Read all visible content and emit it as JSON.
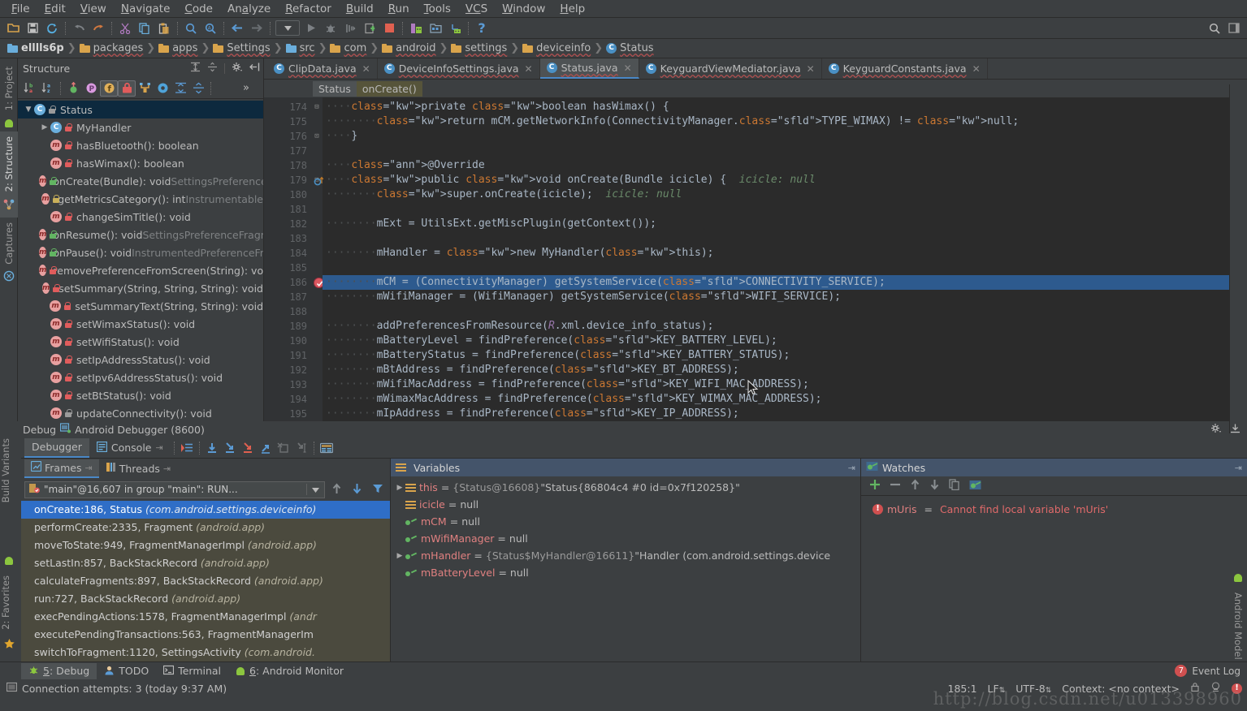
{
  "menubar": {
    "items": [
      "File",
      "Edit",
      "View",
      "Navigate",
      "Code",
      "Analyze",
      "Refactor",
      "Build",
      "Run",
      "Tools",
      "VCS",
      "Window",
      "Help"
    ]
  },
  "toolbar": {
    "icons": [
      "open-folder-icon",
      "save-all-icon",
      "sync-icon",
      "undo-icon",
      "redo-icon",
      "cut-icon",
      "copy-icon",
      "paste-icon",
      "find-icon",
      "replace-icon",
      "back-icon",
      "forward-icon",
      "run-config-dropdown",
      "run-icon",
      "debug-icon",
      "run-coverage-icon",
      "attach-debugger-icon",
      "stop-icon",
      "avd-manager-icon",
      "sdk-manager-icon",
      "sync-gradle-icon",
      "help-icon"
    ],
    "right_icons": [
      "search-everywhere-icon",
      "layout-icon"
    ]
  },
  "breadcrumbs": [
    {
      "label": "elllls6p",
      "icon": "module-icon"
    },
    {
      "label": "packages",
      "icon": "folder-icon"
    },
    {
      "label": "apps",
      "icon": "folder-icon"
    },
    {
      "label": "Settings",
      "icon": "folder-icon"
    },
    {
      "label": "src",
      "icon": "source-folder-icon"
    },
    {
      "label": "com",
      "icon": "package-icon"
    },
    {
      "label": "android",
      "icon": "package-icon"
    },
    {
      "label": "settings",
      "icon": "package-icon"
    },
    {
      "label": "deviceinfo",
      "icon": "package-icon"
    },
    {
      "label": "Status",
      "icon": "class-icon"
    }
  ],
  "left_strip": {
    "labels": [
      "1: Project",
      "2: Structure",
      "Captures"
    ],
    "bottom_labels": [
      "Build Variants",
      "2: Favorites"
    ]
  },
  "right_strip": {
    "label": "Android Model"
  },
  "structure": {
    "title": "Structure",
    "header_icons": [
      "expand-all-icon",
      "collapse-all-icon",
      "settings-gear-icon",
      "hide-panel-icon"
    ],
    "toolbar_icons": [
      "sort-by-visibility-icon",
      "sort-alphabetically-icon",
      "show-inherited-icon",
      "show-properties-icon",
      "show-fields-icon",
      "show-non-public-icon",
      "group-by-icon",
      "show-anonymous-icon",
      "expand-all-icon",
      "collapse-all-icon",
      "more-icon"
    ],
    "tree": [
      {
        "label": "Status",
        "kind": "class",
        "vis": "package",
        "expand": "open",
        "indent": 0,
        "selected": true
      },
      {
        "label": "MyHandler",
        "kind": "class",
        "vis": "private",
        "expand": "closed",
        "indent": 1
      },
      {
        "label": "hasBluetooth(): boolean",
        "kind": "method",
        "vis": "private",
        "indent": 1
      },
      {
        "label": "hasWimax(): boolean",
        "kind": "method",
        "vis": "private",
        "indent": 1
      },
      {
        "label": "onCreate(Bundle): void",
        "suffix": "SettingsPreferenceFragment",
        "kind": "method",
        "vis": "public",
        "indent": 1
      },
      {
        "label": "getMetricsCategory(): int",
        "suffix": "Instrumentable",
        "kind": "method",
        "vis": "key",
        "indent": 1
      },
      {
        "label": "changeSimTitle(): void",
        "kind": "method",
        "vis": "private",
        "indent": 1
      },
      {
        "label": "onResume(): void",
        "suffix": "SettingsPreferenceFragment",
        "kind": "method",
        "vis": "public",
        "indent": 1
      },
      {
        "label": "onPause(): void",
        "suffix": "InstrumentedPreferenceFragment",
        "kind": "method",
        "vis": "public",
        "indent": 1
      },
      {
        "label": "removePreferenceFromScreen(String): void",
        "kind": "method",
        "vis": "private",
        "indent": 1
      },
      {
        "label": "setSummary(String, String, String): void",
        "kind": "method",
        "vis": "private",
        "indent": 1
      },
      {
        "label": "setSummaryText(String, String): void",
        "kind": "method",
        "vis": "private",
        "indent": 1
      },
      {
        "label": "setWimaxStatus(): void",
        "kind": "method",
        "vis": "private",
        "indent": 1
      },
      {
        "label": "setWifiStatus(): void",
        "kind": "method",
        "vis": "private",
        "indent": 1
      },
      {
        "label": "setIpAddressStatus(): void",
        "kind": "method",
        "vis": "private",
        "indent": 1
      },
      {
        "label": "setIpv6AddressStatus(): void",
        "kind": "method",
        "vis": "private",
        "indent": 1
      },
      {
        "label": "setBtStatus(): void",
        "kind": "method",
        "vis": "private",
        "indent": 1
      },
      {
        "label": "updateConnectivity(): void",
        "kind": "method",
        "vis": "package",
        "indent": 1
      }
    ]
  },
  "editor": {
    "tabs": [
      {
        "label": "ClipData.java",
        "active": false
      },
      {
        "label": "DeviceInfoSettings.java",
        "active": false
      },
      {
        "label": "Status.java",
        "active": true
      },
      {
        "label": "KeyguardViewMediator.java",
        "active": false
      },
      {
        "label": "KeyguardConstants.java",
        "active": false
      }
    ],
    "breadcrumb_chips": [
      "Status",
      "onCreate()"
    ],
    "first_line_no": 174,
    "lines": [
      {
        "no": 174,
        "text": "    private boolean hasWimax() {"
      },
      {
        "no": 175,
        "text": "        return mCM.getNetworkInfo(ConnectivityManager.TYPE_WIMAX) != null;"
      },
      {
        "no": 176,
        "text": "    }"
      },
      {
        "no": 177,
        "text": ""
      },
      {
        "no": 178,
        "text": "    @Override"
      },
      {
        "no": 179,
        "text": "    public void onCreate(Bundle icicle) {  icicle: null"
      },
      {
        "no": 180,
        "text": "        super.onCreate(icicle);  icicle: null"
      },
      {
        "no": 181,
        "text": ""
      },
      {
        "no": 182,
        "text": "        mExt = UtilsExt.getMiscPlugin(getContext());"
      },
      {
        "no": 183,
        "text": ""
      },
      {
        "no": 184,
        "text": "        mHandler = new MyHandler(this);"
      },
      {
        "no": 185,
        "text": ""
      },
      {
        "no": 186,
        "text": "        mCM = (ConnectivityManager) getSystemService(CONNECTIVITY_SERVICE);",
        "highlight": true,
        "breakpoint": true
      },
      {
        "no": 187,
        "text": "        mWifiManager = (WifiManager) getSystemService(WIFI_SERVICE);"
      },
      {
        "no": 188,
        "text": ""
      },
      {
        "no": 189,
        "text": "        addPreferencesFromResource(R.xml.device_info_status);"
      },
      {
        "no": 190,
        "text": "        mBatteryLevel = findPreference(KEY_BATTERY_LEVEL);"
      },
      {
        "no": 191,
        "text": "        mBatteryStatus = findPreference(KEY_BATTERY_STATUS);"
      },
      {
        "no": 192,
        "text": "        mBtAddress = findPreference(KEY_BT_ADDRESS);"
      },
      {
        "no": 193,
        "text": "        mWifiMacAddress = findPreference(KEY_WIFI_MAC_ADDRESS);"
      },
      {
        "no": 194,
        "text": "        mWimaxMacAddress = findPreference(KEY_WIMAX_MAC_ADDRESS);"
      },
      {
        "no": 195,
        "text": "        mIpAddress = findPreference(KEY_IP_ADDRESS);"
      }
    ]
  },
  "debug": {
    "title": "Debug",
    "session": "Android Debugger (8600)",
    "tabs": [
      {
        "label": "Debugger",
        "active": true,
        "icon": "debugger-icon"
      },
      {
        "label": "Console",
        "active": false,
        "icon": "console-icon"
      }
    ],
    "step_icons": [
      "show-execution-point-icon",
      "step-over-icon",
      "step-into-icon",
      "force-step-into-icon",
      "step-out-icon",
      "drop-frame-icon",
      "run-to-cursor-icon",
      "evaluate-expression-icon"
    ],
    "left_strip_icons": [
      "rerun-icon",
      "resume-icon",
      "pause-icon",
      "stop-icon",
      "view-breakpoints-icon",
      "mute-breakpoints-icon",
      "screenshot-icon",
      "layout-icon",
      "settings-icon",
      "more-icon"
    ],
    "frames_pane": {
      "tabs": [
        {
          "label": "Frames",
          "active": true,
          "icon": "frames-icon"
        },
        {
          "label": "Threads",
          "active": false,
          "icon": "threads-icon"
        }
      ],
      "thread_selector": "\"main\"@16,607 in group \"main\": RUN...",
      "thread_toolbar_icons": [
        "up-icon",
        "down-icon",
        "filter-icon"
      ],
      "frames": [
        {
          "method": "onCreate:186, Status",
          "pkg": "(com.android.settings.deviceinfo)",
          "selected": true
        },
        {
          "method": "performCreate:2335, Fragment",
          "pkg": "(android.app)"
        },
        {
          "method": "moveToState:949, FragmentManagerImpl",
          "pkg": "(android.app)"
        },
        {
          "method": "setLastIn:857, BackStackRecord",
          "pkg": "(android.app)"
        },
        {
          "method": "calculateFragments:897, BackStackRecord",
          "pkg": "(android.app)"
        },
        {
          "method": "run:727, BackStackRecord",
          "pkg": "(android.app)"
        },
        {
          "method": "execPendingActions:1578, FragmentManagerImpl",
          "pkg": "(andr"
        },
        {
          "method": "executePendingTransactions:563, FragmentManagerIm",
          "pkg": ""
        },
        {
          "method": "switchToFragment:1120, SettingsActivity",
          "pkg": "(com.android."
        }
      ]
    },
    "variables_pane": {
      "title": "Variables",
      "rows": [
        {
          "expandable": true,
          "icon": "field-icon",
          "name": "this",
          "value": "{Status@16608} \"Status{86804c4 #0 id=0x7f120258}\"",
          "ref": "{Status@16608}",
          "str": "\"Status{86804c4 #0 id=0x7f120258}\""
        },
        {
          "expandable": false,
          "icon": "field-icon",
          "name": "icicle",
          "value": "null"
        },
        {
          "expandable": false,
          "icon": "watch-icon",
          "name": "mCM",
          "value": "null"
        },
        {
          "expandable": false,
          "icon": "watch-icon",
          "name": "mWifiManager",
          "value": "null"
        },
        {
          "expandable": true,
          "icon": "watch-icon",
          "name": "mHandler",
          "ref": "{Status$MyHandler@16611}",
          "str": "\"Handler (com.android.settings.device"
        },
        {
          "expandable": false,
          "icon": "watch-icon",
          "name": "mBatteryLevel",
          "value": "null"
        }
      ]
    },
    "watches_pane": {
      "title": "Watches",
      "toolbar_icons": [
        "add-watch-icon",
        "remove-watch-icon",
        "move-up-icon",
        "move-down-icon",
        "duplicate-icon",
        "watch-icon"
      ],
      "rows": [
        {
          "name": "mUris",
          "error": "Cannot find local variable 'mUris'"
        }
      ]
    }
  },
  "statusbar": {
    "tool_buttons": [
      {
        "label": "5: Debug",
        "num": "5",
        "active": true,
        "icon": "debug-icon"
      },
      {
        "label": "TODO",
        "active": false,
        "icon": "todo-icon"
      },
      {
        "label": "Terminal",
        "active": false,
        "icon": "terminal-icon"
      },
      {
        "label": "6: Android Monitor",
        "num": "6",
        "active": false,
        "icon": "android-icon"
      }
    ],
    "event_log": "Event Log",
    "event_log_count": "7",
    "message": "Connection attempts: 3 (today 9:37 AM)",
    "caret": "185:1",
    "line_separator": "LF",
    "encoding": "UTF-8",
    "context": "Context: <no context>",
    "right_icons": [
      "lock-icon",
      "inspection-icon",
      "error-icon"
    ]
  },
  "watermark": "http://blog.csdn.net/u013398960",
  "colors": {
    "bg": "#3c3f41",
    "editor_bg": "#2b2b2b",
    "accent_blue": "#4a88c7",
    "selection": "#2d5a8e",
    "frames_bg": "#4b4a3e",
    "error_red": "#e06a6a"
  }
}
